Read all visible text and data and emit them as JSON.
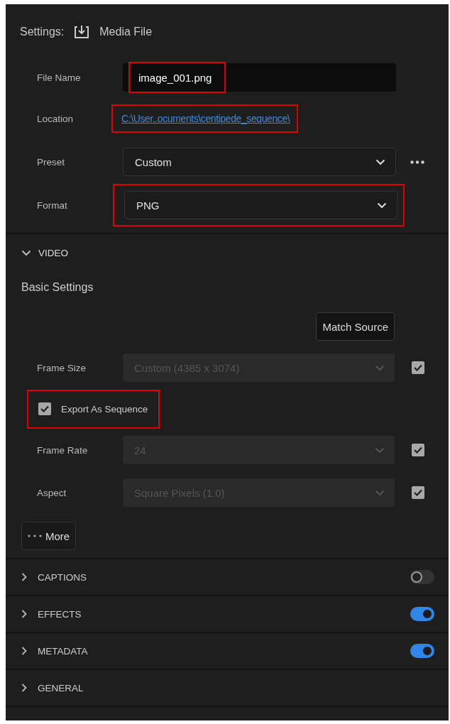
{
  "header": {
    "label": "Settings:",
    "title": "Media File"
  },
  "output": [
    {
      "kind": "text",
      "label": "File Name",
      "value": "image_001.png",
      "highlighted": true
    },
    {
      "kind": "link",
      "label": "Location",
      "value": "C:\\User..ocuments\\centipede_sequence\\",
      "highlighted": true
    },
    {
      "kind": "select",
      "label": "Preset",
      "value": "Custom",
      "highlighted": false,
      "more_menu": true
    },
    {
      "kind": "select",
      "label": "Format",
      "value": "PNG",
      "highlighted": true
    }
  ],
  "video": {
    "title": "VIDEO",
    "expanded": true,
    "subtitle": "Basic Settings",
    "match_button": "Match Source",
    "rows": [
      {
        "kind": "select",
        "label": "Frame Size",
        "value": "Custom (4385 x 3074)",
        "disabled": true,
        "checked": true
      },
      {
        "kind": "checkbox",
        "label": "Export As Sequence",
        "checked": true,
        "highlighted": true
      },
      {
        "kind": "select",
        "label": "Frame Rate",
        "value": "24",
        "disabled": true,
        "checked": true
      },
      {
        "kind": "select",
        "label": "Aspect",
        "value": "Square Pixels (1.0)",
        "disabled": true,
        "checked": true
      }
    ],
    "more_button": "More"
  },
  "sections": [
    {
      "title": "CAPTIONS",
      "expanded": false,
      "on": false
    },
    {
      "title": "EFFECTS",
      "expanded": false,
      "on": true
    },
    {
      "title": "METADATA",
      "expanded": false,
      "on": true
    },
    {
      "title": "GENERAL",
      "expanded": false
    }
  ]
}
